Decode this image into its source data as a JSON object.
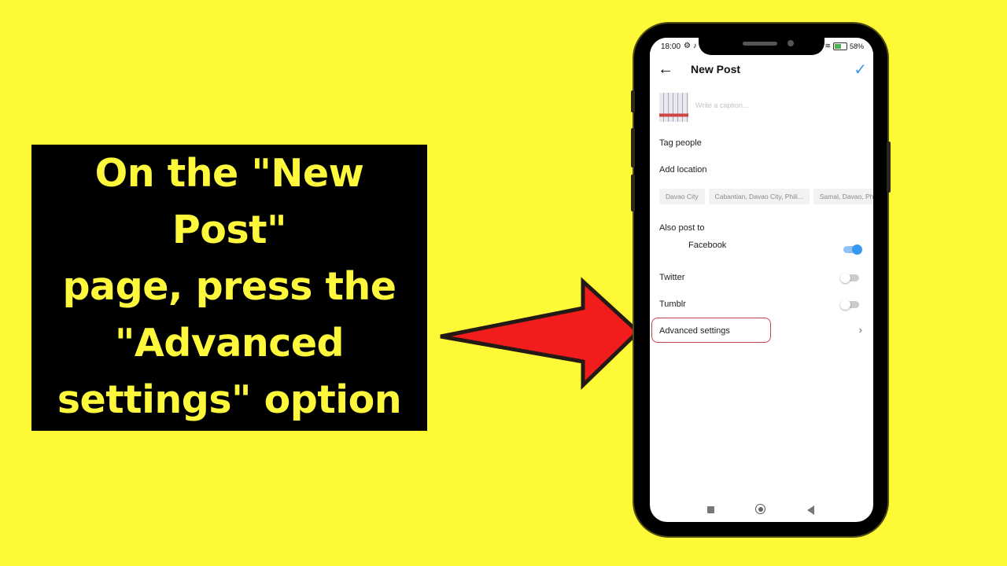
{
  "callout": {
    "text": "On the \"New Post\"\npage, press the\n\"Advanced\nsettings\" option"
  },
  "colors": {
    "background": "#fef936",
    "callout_bg": "#000000",
    "callout_text": "#fdf83b",
    "arrow_fill": "#f21c1c",
    "highlight_border": "#c0474f",
    "accent_blue": "#3897f0"
  },
  "status_bar": {
    "time": "18:00",
    "left_icons": "⚙ ♪",
    "wifi_icon": "wifi-icon",
    "battery_percent": "58%"
  },
  "header": {
    "back_icon": "←",
    "title": "New Post",
    "confirm_icon": "✓"
  },
  "caption": {
    "placeholder": "Write a caption..."
  },
  "rows": {
    "tag_people": "Tag people",
    "add_location": "Add location",
    "also_post_to": "Also post to",
    "facebook": "Facebook",
    "twitter": "Twitter",
    "tumblr": "Tumblr",
    "advanced_settings": "Advanced settings",
    "advanced_chevron": "›"
  },
  "location_chips": [
    "Davao City",
    "Cabantian, Davao City, Phili...",
    "Samal, Davao, Ph"
  ],
  "toggles": {
    "facebook": true,
    "twitter": false,
    "tumblr": false
  }
}
